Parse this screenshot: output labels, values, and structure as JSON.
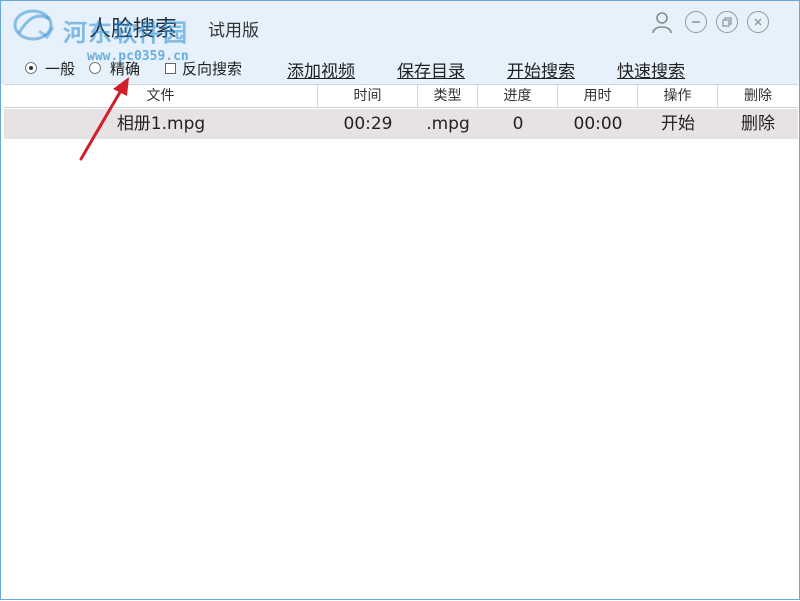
{
  "window": {
    "title": "人脸搜索",
    "edition": "试用版",
    "watermark": "河东软件园",
    "watermark_url": "www.pc0359.cn"
  },
  "options": {
    "mode_general": "一般",
    "mode_precise": "精确",
    "reverse_search": "反向搜索",
    "selected_mode": "一般",
    "reverse_checked": false
  },
  "actions": {
    "add_video": "添加视频",
    "save_dir": "保存目录",
    "start_search": "开始搜索",
    "quick_search": "快速搜索"
  },
  "table": {
    "columns": [
      "文件",
      "时间",
      "类型",
      "进度",
      "用时",
      "操作",
      "删除"
    ],
    "rows": [
      {
        "file": "相册1.mpg",
        "time": "00:29",
        "type": ".mpg",
        "progress": "0",
        "elapsed": "00:00",
        "action": "开始",
        "delete": "删除"
      }
    ]
  },
  "icons": {
    "user": "user-icon",
    "minimize": "minimize-icon",
    "restore": "restore-icon",
    "close": "close-icon"
  },
  "colors": {
    "titlebar_bg": "#e6f1fb",
    "window_border": "#6aa6dc",
    "row_bg": "#e7e3e4",
    "annotation_arrow": "#d21e2a"
  }
}
